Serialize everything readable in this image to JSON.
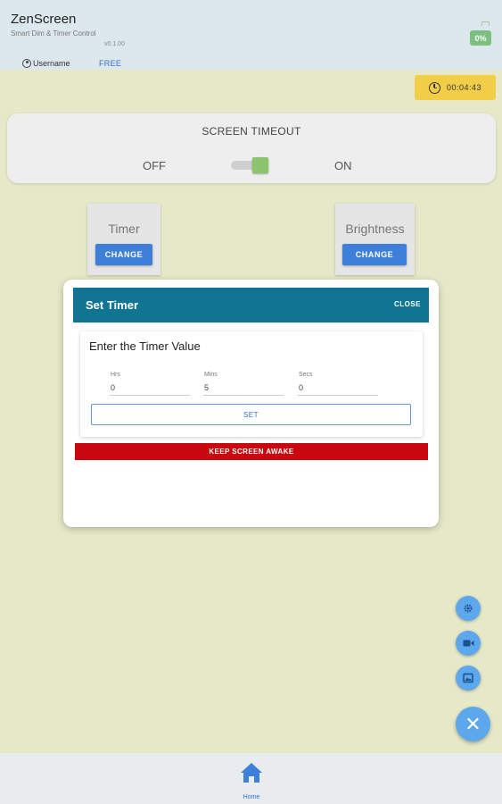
{
  "header": {
    "app_name": "ZenScreen",
    "subtitle": "Smart Dim & Timer Control",
    "version": "v0.1.00",
    "username": "Username",
    "plan": "FREE",
    "battery": "0%"
  },
  "countdown": {
    "value": "00:04:43",
    "icon": "clock-icon"
  },
  "screen_timeout": {
    "title": "SCREEN TIMEOUT",
    "off_label": "OFF",
    "on_label": "ON",
    "enabled": true
  },
  "controls": {
    "timer": {
      "title": "Timer",
      "button": "CHANGE"
    },
    "brightness": {
      "title": "Brightness",
      "button": "CHANGE"
    }
  },
  "modal": {
    "title": "Set Timer",
    "close_label": "CLOSE",
    "prompt": "Enter the Timer Value",
    "fields": [
      {
        "label": "Hrs",
        "value": "0"
      },
      {
        "label": "Mins",
        "value": "5"
      },
      {
        "label": "Secs",
        "value": "0"
      }
    ],
    "set_label": "SET",
    "keep_awake_label": "KEEP SCREEN AWAKE"
  },
  "fabs": {
    "items": [
      "settings-icon",
      "video-icon",
      "gallery-icon"
    ],
    "main_icon": "close-icon",
    "main_glyph": "✕"
  },
  "nav": {
    "home_label": "Home"
  },
  "colors": {
    "background": "#e6e9c8",
    "accent": "#3e7fd9",
    "modal_header": "#0f7592",
    "danger": "#c8070e",
    "countdown": "#f2cd48",
    "toggle_on": "#8cc46e"
  }
}
